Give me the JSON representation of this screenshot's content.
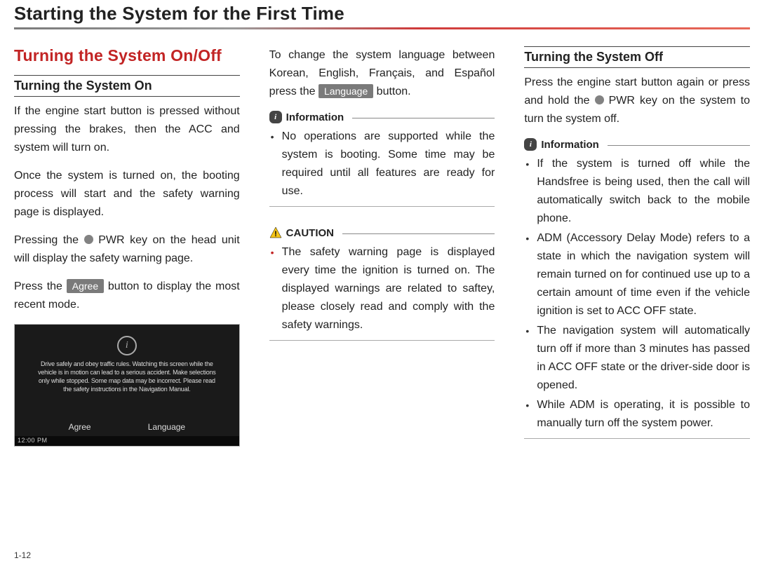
{
  "page_title": "Starting the System for the First Time",
  "page_number": "1-12",
  "col1": {
    "section": "Turning the System On/Off",
    "sub1": "Turning the System On",
    "p1": "If the engine start button is pressed without pressing the brakes, then the ACC and system will turn on.",
    "p2": "Once the system is turned on, the booting process will start and the safety warning page is displayed.",
    "p3a": "Pressing the ",
    "p3b": " PWR key on the head unit will display the safety warning page.",
    "p4a": "Press the ",
    "p4b": " button to display the most recent mode.",
    "agree_btn": "Agree",
    "screenshot": {
      "warn": "Drive safely and obey traffic rules. Watching this screen while the vehicle is in motion can lead to a serious accident. Make selections only while stopped. Some map data may be incorrect. Please read the safety instructions in the Navigation Manual.",
      "btn_left": "Agree",
      "btn_right": "Language",
      "status": "12:00 PM"
    }
  },
  "col2": {
    "p1a": "To change the system language between Korean, English, Français, and Español press the ",
    "p1b": " button.",
    "language_btn": "Language",
    "info_label": "Information",
    "info1": "No operations are supported while the system is booting. Some time may be required until all features are ready for use.",
    "caution_label": "CAUTION",
    "caution1": "The safety warning page is displayed every time the ignition is turned on. The displayed warnings are related to saftey, please closely read and comply with the safety warnings."
  },
  "col3": {
    "sub1": "Turning the System Off",
    "p1a": "Press the engine start button again or press and hold the ",
    "p1b": " PWR key on the system to turn the system off.",
    "info_label": "Information",
    "b1": "If the system is turned off while the Handsfree is being used, then the call will automatically switch back to the mobile phone.",
    "b2": "ADM (Accessory Delay Mode) refers to a state in which the navigation system will remain turned on for continued use up to a certain amount of time even if the vehicle ignition is set to ACC OFF state.",
    "b3": "The navigation system will automatically turn off if more than 3 minutes has passed in ACC OFF state or the driver-side door is opened.",
    "b4": "While ADM is operating, it is possible to manually turn off the system power."
  }
}
